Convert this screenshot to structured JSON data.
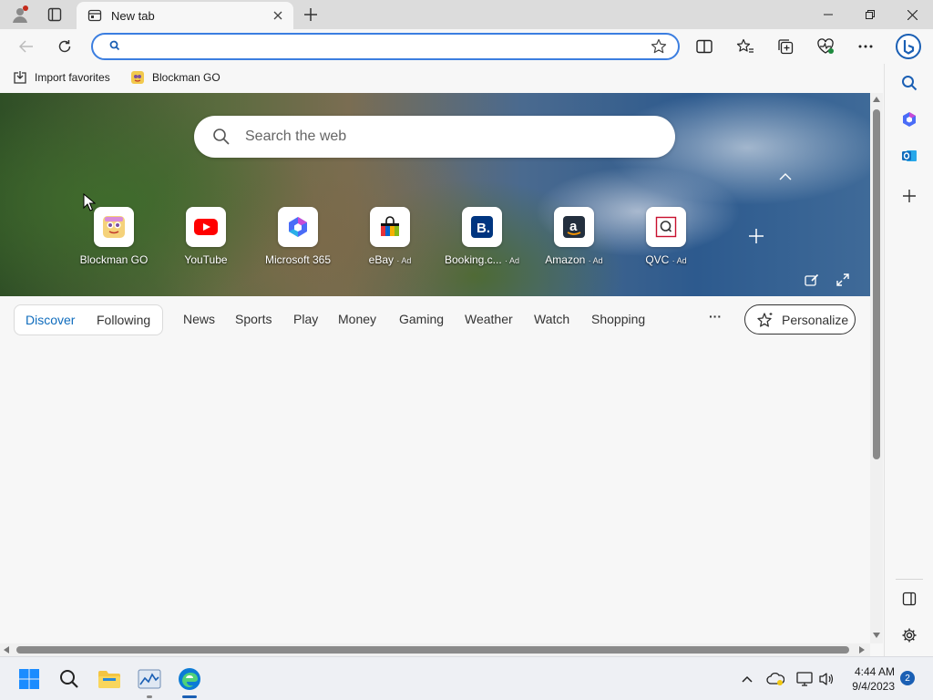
{
  "tabstrip": {
    "tab_title": "New tab"
  },
  "toolbar": {
    "address_value": "",
    "address_placeholder": ""
  },
  "favorites": {
    "items": [
      {
        "label": "Import favorites",
        "icon": "import-icon"
      },
      {
        "label": "Blockman GO",
        "icon": "blockman-icon"
      }
    ]
  },
  "newtab": {
    "search_placeholder": "Search the web",
    "tiles": [
      {
        "label": "Blockman GO",
        "ad": ""
      },
      {
        "label": "YouTube",
        "ad": ""
      },
      {
        "label": "Microsoft 365",
        "ad": ""
      },
      {
        "label": "eBay",
        "ad": "· Ad"
      },
      {
        "label": "Booking.c...",
        "ad": "· Ad"
      },
      {
        "label": "Amazon",
        "ad": "· Ad"
      },
      {
        "label": "QVC",
        "ad": "· Ad"
      }
    ],
    "feed_pills": [
      "Discover",
      "Following"
    ],
    "feed_tabs": [
      "News",
      "Sports",
      "Play",
      "Money",
      "Gaming",
      "Weather",
      "Watch",
      "Shopping"
    ],
    "more_label": "···",
    "personalize_label": "Personalize"
  },
  "taskbar": {
    "time": "4:44 AM",
    "date": "9/4/2023",
    "notifications": "2"
  },
  "colors": {
    "accent": "#0f6cbd",
    "address_border": "#3b7ee0"
  }
}
